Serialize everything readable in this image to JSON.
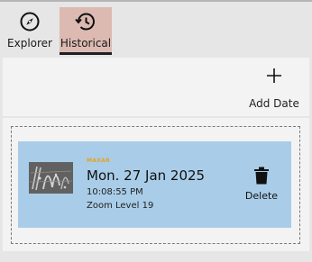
{
  "tabs": [
    {
      "label": "Explorer",
      "icon": "compass-icon"
    },
    {
      "label": "Historical",
      "icon": "history-icon",
      "active": true
    }
  ],
  "toolbar": {
    "add_date_label": "Add Date",
    "add_icon": "plus-icon"
  },
  "entries": [
    {
      "provider": "MAXAR",
      "date": "Mon. 27 Jan 2025",
      "time": "10:08:55 PM",
      "zoom": "Zoom Level 19",
      "delete_label": "Delete",
      "delete_icon": "trash-icon"
    }
  ],
  "colors": {
    "active_tab_bg": "#dcbab2",
    "card_bg": "#a9cde8",
    "provider_text": "#e2a325"
  }
}
